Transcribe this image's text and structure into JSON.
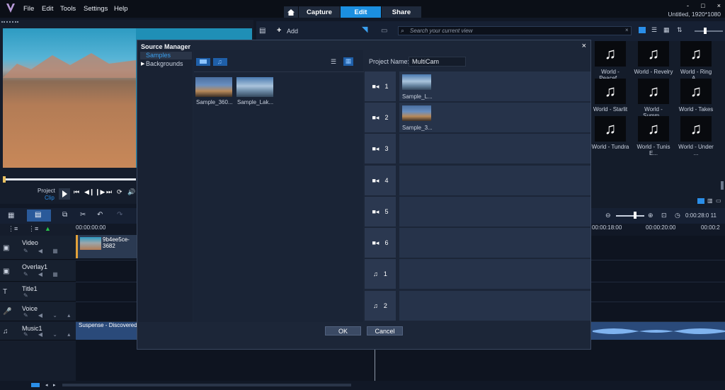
{
  "menu": [
    "File",
    "Edit",
    "Tools",
    "Settings",
    "Help"
  ],
  "modes": {
    "capture": "Capture",
    "edit": "Edit",
    "share": "Share"
  },
  "window": {
    "title": "Untitled, 1920*1080",
    "minimize": "-",
    "maximize": "□",
    "close": "×"
  },
  "player": {
    "project_label": "Project",
    "clip_label": "Clip"
  },
  "library": {
    "add_label": "Add",
    "search_placeholder": "Search your current view",
    "items": [
      "World - Peacef...",
      "World - Revelry",
      "World - Ring A...",
      "World - Starlit ...",
      "World - Summ...",
      "World - Takes ...",
      "World - Tundra",
      "World - Tunis E...",
      "World - Under ..."
    ]
  },
  "timeline": {
    "ruler": {
      "start": "00:00:00:00",
      "t18": "00:00:18:00",
      "t20": "00:00:20:00",
      "t22": "00:00:2",
      "timecode": "0:00:28:0 11"
    },
    "tracks": [
      {
        "name": "Video",
        "icon": "video-track-icon"
      },
      {
        "name": "Overlay1",
        "icon": "overlay-track-icon"
      },
      {
        "name": "Title1",
        "icon": "title-track-icon"
      },
      {
        "name": "Voice",
        "icon": "voice-track-icon"
      },
      {
        "name": "Music1",
        "icon": "music-track-icon"
      }
    ],
    "video_clip": "9b4ee5ce-3682",
    "music_clip": "Suspense - Discovered"
  },
  "dialog": {
    "title": "Source Manager",
    "close": "×",
    "tree": [
      "Samples",
      "Backgrounds"
    ],
    "media": [
      {
        "label": "Sample_360..."
      },
      {
        "label": "Sample_Lak..."
      }
    ],
    "project_name_label": "Project Name:",
    "project_name_value": "MultiCam",
    "slots": [
      {
        "type": "camera",
        "num": "1",
        "clip": "Sample_L..."
      },
      {
        "type": "camera",
        "num": "2",
        "clip": "Sample_3..."
      },
      {
        "type": "camera",
        "num": "3",
        "clip": ""
      },
      {
        "type": "camera",
        "num": "4",
        "clip": ""
      },
      {
        "type": "camera",
        "num": "5",
        "clip": ""
      },
      {
        "type": "camera",
        "num": "6",
        "clip": ""
      },
      {
        "type": "audio",
        "num": "1",
        "clip": ""
      },
      {
        "type": "audio",
        "num": "2",
        "clip": ""
      }
    ],
    "ok": "OK",
    "cancel": "Cancel"
  }
}
